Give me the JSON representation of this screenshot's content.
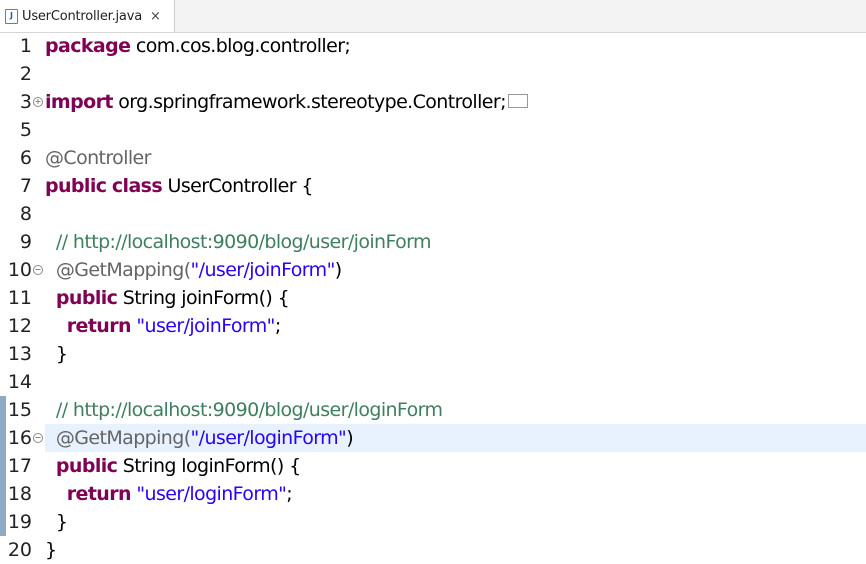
{
  "tab": {
    "label": "UserController.java",
    "icon": "java-file-icon",
    "close": "×"
  },
  "lines": [
    {
      "n": "1"
    },
    {
      "n": "2"
    },
    {
      "n": "3"
    },
    {
      "n": "5"
    },
    {
      "n": "6"
    },
    {
      "n": "7"
    },
    {
      "n": "8"
    },
    {
      "n": "9"
    },
    {
      "n": "10"
    },
    {
      "n": "11"
    },
    {
      "n": "12"
    },
    {
      "n": "13"
    },
    {
      "n": "14"
    },
    {
      "n": "15"
    },
    {
      "n": "16"
    },
    {
      "n": "17"
    },
    {
      "n": "18"
    },
    {
      "n": "19"
    },
    {
      "n": "20"
    }
  ],
  "code": {
    "l1": {
      "kw": "package",
      "rest": " com.cos.blog.controller;"
    },
    "l3": {
      "kw": "import",
      "rest": " org.springframework.stereotype.Controller;"
    },
    "l6": {
      "ann": "@Controller"
    },
    "l7": {
      "kw1": "public",
      "kw2": "class",
      "rest": " UserController {"
    },
    "l9": {
      "cm": "// http://localhost:9090/blog/user/joinForm"
    },
    "l10": {
      "ann": "@GetMapping(",
      "str": "\"/user/joinForm\"",
      "end": ")"
    },
    "l11": {
      "kw": "public",
      "rest": " String joinForm() {"
    },
    "l12": {
      "kw": "return",
      "str": "\"user/joinForm\"",
      "end": ";"
    },
    "l13": {
      "rest": "}"
    },
    "l15": {
      "cm": "// http://localhost:9090/blog/user/loginForm"
    },
    "l16": {
      "ann": "@GetMapping(",
      "str": "\"/user/loginForm\"",
      "end": ")"
    },
    "l17": {
      "kw": "public",
      "rest": " String loginForm() {"
    },
    "l18": {
      "kw": "return",
      "str": "\"user/loginForm\"",
      "end": ";"
    },
    "l19": {
      "rest": "}"
    },
    "l20": {
      "rest": "}"
    }
  },
  "colors": {
    "keyword": "#7f0055",
    "comment": "#3f7f5f",
    "string": "#2a00ff",
    "current_line": "#e8f2fe"
  }
}
